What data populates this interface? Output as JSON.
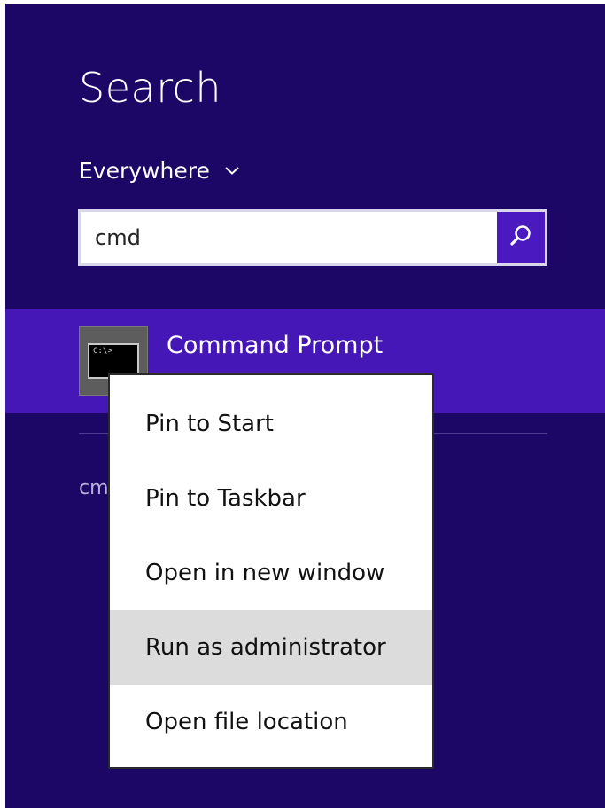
{
  "search": {
    "title": "Search",
    "scope": {
      "label": "Everywhere",
      "icon": "chevron-down-icon"
    },
    "query": "cmd",
    "button_icon": "search-icon"
  },
  "results": {
    "top": {
      "title": "Command Prompt",
      "icon": "command-prompt-icon",
      "icon_prompt": "C:\\>"
    },
    "secondary": "cm"
  },
  "context_menu": {
    "items": [
      {
        "label": "Pin to Start"
      },
      {
        "label": "Pin to Taskbar"
      },
      {
        "label": "Open in new window"
      },
      {
        "label": "Run as administrator",
        "highlighted": true
      },
      {
        "label": "Open file location"
      }
    ]
  },
  "colors": {
    "panel_background": "#1d0766",
    "selected_result": "#4617b7",
    "search_button": "#4a19bf",
    "menu_highlight": "#dcdcdc"
  }
}
